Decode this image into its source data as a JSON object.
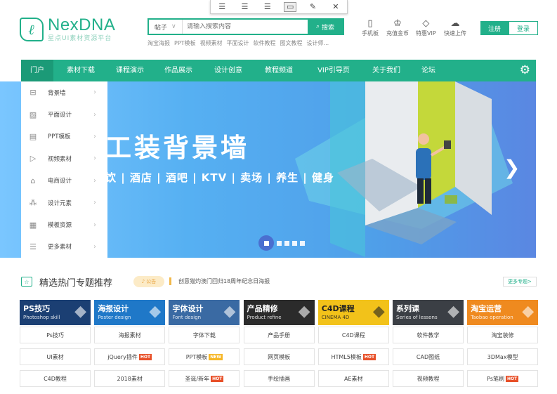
{
  "header": {
    "logo": {
      "name": "NexDNA",
      "slogan": "星点UI素材资源平台"
    },
    "search": {
      "category": "帖子",
      "placeholder": "请输入搜索内容",
      "button": "搜索"
    },
    "hot_keywords": [
      "淘宝海报",
      "PPT模板",
      "视频素材",
      "平面设计",
      "软件教程",
      "图文教程",
      "设计师..."
    ],
    "quick_links": [
      {
        "label": "手机板",
        "icon": "mobile-icon"
      },
      {
        "label": "充值金币",
        "icon": "crown-icon"
      },
      {
        "label": "特惠VIP",
        "icon": "diamond-icon"
      },
      {
        "label": "快速上传",
        "icon": "cloud-upload-icon"
      }
    ],
    "register": "注册",
    "login": "登录"
  },
  "nav": {
    "items": [
      "门户",
      "素材下载",
      "课程演示",
      "作品展示",
      "设计创意",
      "教程频道",
      "VIP引导页",
      "关于我们",
      "论坛"
    ],
    "active": 0,
    "active_color": "#1b9a77"
  },
  "sidebar": {
    "items": [
      {
        "label": "背景墙",
        "icon": "tree-icon"
      },
      {
        "label": "平面设计",
        "icon": "image-icon"
      },
      {
        "label": "PPT模板",
        "icon": "ppt-icon"
      },
      {
        "label": "视频素材",
        "icon": "video-icon"
      },
      {
        "label": "电商设计",
        "icon": "shop-icon"
      },
      {
        "label": "设计元素",
        "icon": "shapes-icon"
      },
      {
        "label": "模板资源",
        "icon": "template-icon"
      },
      {
        "label": "更多素材",
        "icon": "list-icon"
      }
    ]
  },
  "banner": {
    "headline": "工装背景墙",
    "subline": "饮 | 酒店 | 酒吧 | KTV | 卖场 | 养生 | 健身",
    "slide_count": 5,
    "active_slide": 0
  },
  "topics": {
    "title": "精选热门专题推荐",
    "notice_label": "公告",
    "notice_text": "创意猫灼澳门回归18周年纪念日海报",
    "more": "更多专题>",
    "cards": [
      {
        "title": "PS技巧",
        "sub": "Photoshop skill",
        "color": "#1b3f73",
        "icon": "palette-icon"
      },
      {
        "title": "海报设计",
        "sub": "Poster design",
        "color": "#1f78c8",
        "icon": "poster-icon"
      },
      {
        "title": "字体设计",
        "sub": "Font design",
        "color": "#3a6aa3",
        "icon": "font-icon"
      },
      {
        "title": "产品精修",
        "sub": "Product refine",
        "color": "#2b2b2b",
        "icon": "camera-icon"
      },
      {
        "title": "C4D课程",
        "sub": "CINEMA 4D",
        "color": "#f2c21a",
        "icon": "cube-icon"
      },
      {
        "title": "系列课",
        "sub": "Series of lessons",
        "color": "#3b3f45",
        "icon": "book-icon"
      },
      {
        "title": "淘宝运营",
        "sub": "Taobao operation",
        "color": "#ef8a1f",
        "icon": "shop-icon"
      }
    ],
    "rows": [
      [
        {
          "t": "Ps技巧"
        },
        {
          "t": "海报素材"
        },
        {
          "t": "字体下载"
        },
        {
          "t": "产品手册"
        },
        {
          "t": "C4D课程"
        },
        {
          "t": "软件教学"
        },
        {
          "t": "淘宝装修"
        }
      ],
      [
        {
          "t": "UI素材"
        },
        {
          "t": "jQuery插件",
          "tag": "HOT"
        },
        {
          "t": "PPT模板",
          "tag": "NEW"
        },
        {
          "t": "网页模板"
        },
        {
          "t": "HTML5模板",
          "tag": "HOT"
        },
        {
          "t": "CAD图纸"
        },
        {
          "t": "3DMax模型"
        }
      ],
      [
        {
          "t": "C4D教程"
        },
        {
          "t": "2018素材"
        },
        {
          "t": "圣诞/新年",
          "tag": "HOT"
        },
        {
          "t": "手绘插画"
        },
        {
          "t": "AE素材"
        },
        {
          "t": "视频教程"
        },
        {
          "t": "Ps笔刷",
          "tag": "HOT"
        }
      ]
    ]
  }
}
